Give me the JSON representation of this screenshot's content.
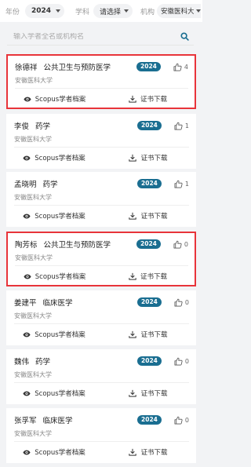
{
  "filters": {
    "year_label": "年份",
    "year_value": "2024",
    "subject_label": "学科",
    "subject_value": "请选择",
    "org_label": "机构",
    "org_value": "安徽医科大"
  },
  "search": {
    "placeholder": "输入学者全名或机构名"
  },
  "actions": {
    "scopus_label": "Scopus学者档案",
    "cert_label": "证书下载"
  },
  "cards": [
    {
      "name": "徐德祥",
      "discipline": "公共卫生与预防医学",
      "institution": "安徽医科大学",
      "year": "2024",
      "likes": "4",
      "highlighted": true
    },
    {
      "name": "李俊",
      "discipline": "药学",
      "institution": "安徽医科大学",
      "year": "2024",
      "likes": "1",
      "highlighted": false
    },
    {
      "name": "孟晓明",
      "discipline": "药学",
      "institution": "安徽医科大学",
      "year": "2024",
      "likes": "1",
      "highlighted": false
    },
    {
      "name": "陶芳标",
      "discipline": "公共卫生与预防医学",
      "institution": "安徽医科大学",
      "year": "2024",
      "likes": "0",
      "highlighted": true
    },
    {
      "name": "姜建平",
      "discipline": "临床医学",
      "institution": "安徽医科大学",
      "year": "2024",
      "likes": "0",
      "highlighted": false
    },
    {
      "name": "魏伟",
      "discipline": "药学",
      "institution": "安徽医科大学",
      "year": "2024",
      "likes": "0",
      "highlighted": false
    },
    {
      "name": "张孚军",
      "discipline": "临床医学",
      "institution": "安徽医科大学",
      "year": "2024",
      "likes": "0",
      "highlighted": false
    }
  ],
  "colors": {
    "badge": "#1a6e91",
    "highlight_border": "#e8343a",
    "search_icon": "#1a6e91"
  },
  "icons": {
    "like": "thumbs-up-icon",
    "scopus": "eye-icon",
    "download": "download-icon",
    "search": "search-icon"
  }
}
